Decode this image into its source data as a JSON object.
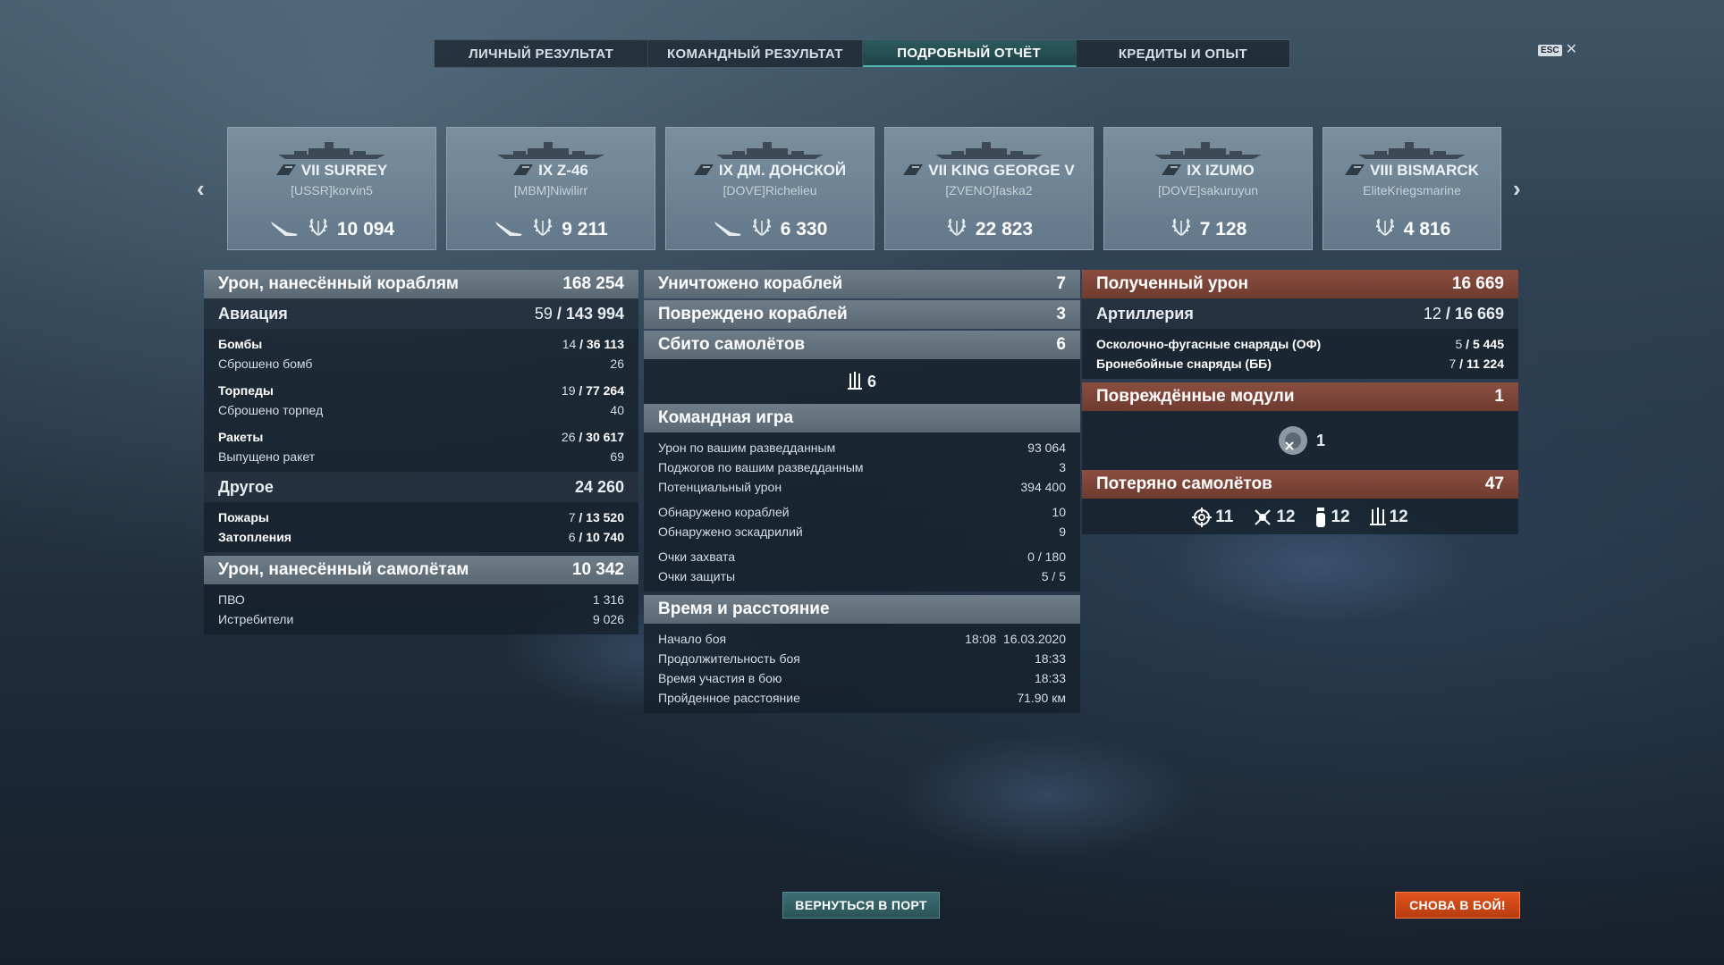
{
  "tabs": [
    "ЛИЧНЫЙ РЕЗУЛЬТАТ",
    "КОМАНДНЫЙ РЕЗУЛЬТАТ",
    "ПОДРОБНЫЙ ОТЧЁТ",
    "КРЕДИТЫ И ОПЫТ"
  ],
  "active_tab_index": 2,
  "esc_label": "ESC",
  "ships": [
    {
      "name": "VII SURREY",
      "player": "[USSR]korvin5",
      "value": "10 094",
      "plane_icon": true
    },
    {
      "name": "IX Z-46",
      "player": "[MBM]Niwilirr",
      "value": "9 211",
      "plane_icon": true
    },
    {
      "name": "IX ДМ. ДОНСКОЙ",
      "player": "[DOVE]Richelieu",
      "value": "6 330",
      "plane_icon": true
    },
    {
      "name": "VII KING GEORGE V",
      "player": "[ZVENO]faska2",
      "value": "22 823",
      "plane_icon": false
    },
    {
      "name": "IX IZUMO",
      "player": "[DOVE]sakuruyun",
      "value": "7 128",
      "plane_icon": false
    },
    {
      "name": "VIII BISMARCK",
      "player": "EliteKriegsmarine",
      "value": "4 816",
      "plane_icon": false
    }
  ],
  "col1": {
    "ship_damage": {
      "label": "Урон, нанесённый кораблям",
      "value": "168 254"
    },
    "aviation": {
      "label": "Авиация",
      "hits": "59",
      "dmg": "143 994"
    },
    "bombs": {
      "label": "Бомбы",
      "hits": "14",
      "dmg": "36 113"
    },
    "bombs_dropped": {
      "label": "Сброшено бомб",
      "value": "26"
    },
    "torpedoes": {
      "label": "Торпеды",
      "hits": "19",
      "dmg": "77 264"
    },
    "torpedoes_dropped": {
      "label": "Сброшено торпед",
      "value": "40"
    },
    "rockets": {
      "label": "Ракеты",
      "hits": "26",
      "dmg": "30 617"
    },
    "rockets_fired": {
      "label": "Выпущено ракет",
      "value": "69"
    },
    "other": {
      "label": "Другое",
      "value": "24 260"
    },
    "fires": {
      "label": "Пожары",
      "hits": "7",
      "dmg": "13 520"
    },
    "floods": {
      "label": "Затопления",
      "hits": "6",
      "dmg": "10 740"
    },
    "plane_damage": {
      "label": "Урон, нанесённый самолётам",
      "value": "10 342"
    },
    "aa": {
      "label": "ПВО",
      "value": "1 316"
    },
    "fighters": {
      "label": "Истребители",
      "value": "9 026"
    }
  },
  "col2": {
    "ships_destroyed": {
      "label": "Уничтожено кораблей",
      "value": "7"
    },
    "ships_damaged": {
      "label": "Повреждено кораблей",
      "value": "3"
    },
    "planes_shot": {
      "label": "Сбито самолётов",
      "value": "6"
    },
    "planes_shot_icon_value": "6",
    "team_play": {
      "label": "Командная игра"
    },
    "spotting_damage": {
      "label": "Урон по вашим разведданным",
      "value": "93 064"
    },
    "spotting_fires": {
      "label": "Поджогов по вашим разведданным",
      "value": "3"
    },
    "potential_damage": {
      "label": "Потенциальный урон",
      "value": "394 400"
    },
    "ships_spotted": {
      "label": "Обнаружено кораблей",
      "value": "10"
    },
    "squadrons_spotted": {
      "label": "Обнаружено эскадрилий",
      "value": "9"
    },
    "capture_points": {
      "label": "Очки захвата",
      "value": "0 / 180"
    },
    "defense_points": {
      "label": "Очки защиты",
      "value": "5 / 5"
    },
    "time_distance": {
      "label": "Время и расстояние"
    },
    "battle_start": {
      "label": "Начало боя",
      "value": "18:08  16.03.2020"
    },
    "battle_duration": {
      "label": "Продолжительность боя",
      "value": "18:33"
    },
    "time_in_battle": {
      "label": "Время участия в бою",
      "value": "18:33"
    },
    "distance": {
      "label": "Пройденное расстояние",
      "value": "71.90 км"
    }
  },
  "col3": {
    "received": {
      "label": "Полученный урон",
      "value": "16 669"
    },
    "artillery": {
      "label": "Артиллерия",
      "hits": "12",
      "dmg": "16 669"
    },
    "he": {
      "label": "Осколочно-фугасные снаряды (ОФ)",
      "hits": "5",
      "dmg": "5 445"
    },
    "ap": {
      "label": "Бронебойные снаряды (ББ)",
      "hits": "7",
      "dmg": "11 224"
    },
    "modules": {
      "label": "Повреждённые модули",
      "value": "1"
    },
    "module_icon_value": "1",
    "planes_lost": {
      "label": "Потеряно самолётов",
      "value": "47"
    },
    "lost_by_type": [
      {
        "icon": "crosshair-icon",
        "value": "11"
      },
      {
        "icon": "torpedo-bomber-icon",
        "value": "12"
      },
      {
        "icon": "bomb-icon",
        "value": "12"
      },
      {
        "icon": "rocket-icon",
        "value": "12"
      }
    ]
  },
  "buttons": {
    "return_port": "ВЕРНУТЬСЯ В ПОРТ",
    "to_battle": "СНОВА В БОЙ!"
  },
  "colors": {
    "accent_teal": "#2c5a5e",
    "battle_orange": "#d04a18",
    "received_red": "#7a4437"
  }
}
